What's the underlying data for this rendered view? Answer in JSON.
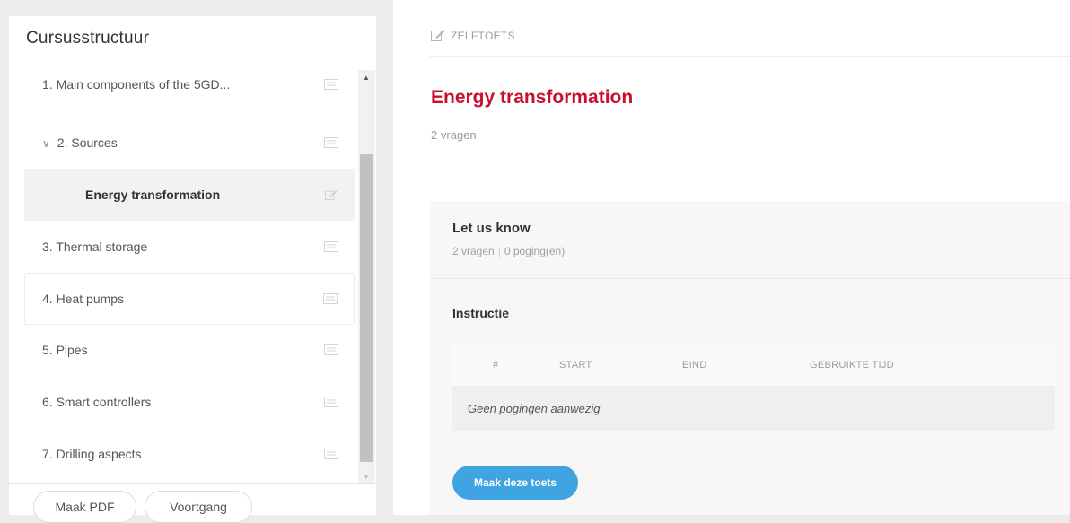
{
  "sidebar": {
    "title": "Cursusstructuur",
    "items": [
      {
        "label": "1. Main components of the 5GD...",
        "icon": "document-icon"
      },
      {
        "label": "2. Sources",
        "icon": "document-icon",
        "expanded": true
      },
      {
        "label": "Energy transformation",
        "icon": "edit-icon",
        "active": true
      },
      {
        "label": "3. Thermal storage",
        "icon": "document-icon"
      },
      {
        "label": "4. Heat pumps",
        "icon": "document-icon"
      },
      {
        "label": "5. Pipes",
        "icon": "document-icon"
      },
      {
        "label": "6. Smart controllers",
        "icon": "document-icon"
      },
      {
        "label": "7. Drilling aspects",
        "icon": "document-icon"
      }
    ],
    "footer": {
      "pdf_button": "Maak PDF",
      "progress_button": "Voortgang"
    }
  },
  "main": {
    "breadcrumb": "ZELFTOETS",
    "title": "Energy transformation",
    "subtitle": "2 vragen",
    "card": {
      "title": "Let us know",
      "questions": "2 vragen",
      "attempts": "0 poging(en)",
      "instruction_title": "Instructie",
      "table": {
        "headers": [
          "#",
          "START",
          "EIND",
          "GEBRUIKTE TIJD"
        ],
        "empty_text": "Geen pogingen aanwezig"
      },
      "button": "Maak deze toets"
    }
  },
  "colors": {
    "title_red": "#c8102e",
    "button_blue": "#3fa4e1"
  }
}
